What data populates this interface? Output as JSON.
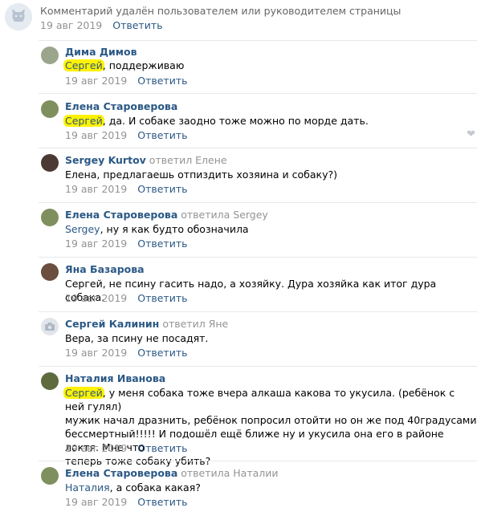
{
  "deleted_comment": {
    "text": "Комментарий удалён пользователем или руководителем страницы",
    "date": "19 авг 2019",
    "reply": "Ответить"
  },
  "comments": [
    {
      "author": "Дима Димов",
      "replied": "",
      "mention": "Сергей",
      "text": ", поддерживаю",
      "date": "19 авг 2019",
      "reply": "Ответить"
    },
    {
      "author": "Елена Староверова",
      "replied": "",
      "mention": "Сергей",
      "text": ", да. И собаке заодно тоже можно по морде дать.",
      "date": "19 авг 2019",
      "reply": "Ответить"
    },
    {
      "author": "Sergey Kurtov",
      "replied": "ответил Елене",
      "mention": "",
      "text": "Елена, предлагаешь отпиздить хозяина и собаку?)",
      "date": "19 авг 2019",
      "reply": "Ответить"
    },
    {
      "author": "Елена Староверова",
      "replied": "ответила Sergey",
      "mention": "Sergey",
      "text": ", ну я как будто обозначила",
      "date": "19 авг 2019",
      "reply": "Ответить"
    },
    {
      "author": "Яна Базарова",
      "replied": "",
      "mention": "",
      "text": "Сергей, не псину гасить надо, а хозяйку. Дура хозяйка как итог дура собака.",
      "date": "19 авг 2019",
      "reply": "Ответить"
    },
    {
      "author": "Сергей Калинин",
      "replied": "ответил Яне",
      "mention": "",
      "text": "Вера, за псину не посадят.",
      "date": "19 авг 2019",
      "reply": "Ответить"
    },
    {
      "author": "Наталия Иванова",
      "replied": "",
      "mention": "Сергей",
      "text": ", у меня собака тоже вчера алкаша какова то укусила. (ребёнок с ней гулял)\nмужик начал дразнить, ребёнок попросил отойти но он же под 40градусами\nбессмертный!!!!! И подошёл ещё ближе ну и укусила она его в районе локтя. Мне что\nтеперь тоже собаку убить?",
      "date": "19 авг 2019",
      "reply": "Ответить"
    },
    {
      "author": "Елена Староверова",
      "replied": "ответила Наталии",
      "mention": "Наталия",
      "text": ", а собака какая?",
      "date": "19 авг 2019",
      "reply": "Ответить"
    }
  ],
  "icons": {
    "avatar_placeholder": "vk-dog-icon",
    "like": "heart-icon",
    "no_photo": "camera-icon"
  },
  "colors": {
    "link": "#2a5885",
    "muted": "#939393",
    "highlight": "#fff200"
  }
}
